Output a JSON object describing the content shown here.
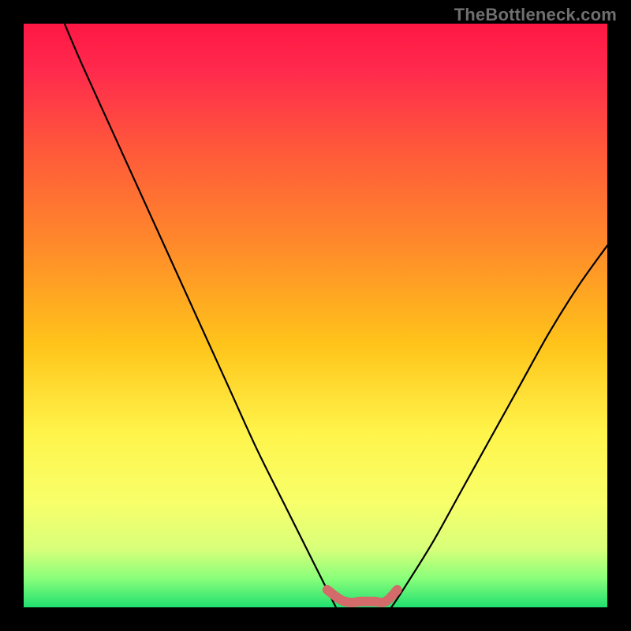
{
  "watermark": "TheBottleneck.com",
  "chart_data": {
    "type": "line",
    "title": "",
    "xlabel": "",
    "ylabel": "",
    "xlim": [
      0,
      100
    ],
    "ylim": [
      0,
      100
    ],
    "series": [
      {
        "name": "left-curve",
        "x": [
          7,
          10,
          15,
          20,
          25,
          30,
          35,
          40,
          45,
          50,
          53.5
        ],
        "values": [
          100,
          93,
          82,
          71,
          60,
          49,
          38,
          27,
          17,
          7,
          0
        ]
      },
      {
        "name": "right-curve",
        "x": [
          63,
          65,
          70,
          75,
          80,
          85,
          90,
          95,
          100
        ],
        "values": [
          0,
          3,
          11,
          20,
          29,
          38,
          47,
          55,
          62
        ]
      },
      {
        "name": "bottom-accent",
        "x": [
          52,
          55,
          58,
          60,
          62,
          64
        ],
        "values": [
          3,
          1,
          1,
          1,
          1,
          3
        ]
      }
    ],
    "gradient_stops": [
      {
        "offset": 0.0,
        "color": "#ff1744"
      },
      {
        "offset": 0.08,
        "color": "#ff2a4d"
      },
      {
        "offset": 0.22,
        "color": "#ff5a3a"
      },
      {
        "offset": 0.38,
        "color": "#ff8a2a"
      },
      {
        "offset": 0.55,
        "color": "#ffc41a"
      },
      {
        "offset": 0.7,
        "color": "#fff44a"
      },
      {
        "offset": 0.82,
        "color": "#f8ff6a"
      },
      {
        "offset": 0.9,
        "color": "#d8ff7a"
      },
      {
        "offset": 0.95,
        "color": "#8aff7a"
      },
      {
        "offset": 1.0,
        "color": "#20e070"
      }
    ],
    "accent_color": "#d36b6b",
    "curve_color": "#000000"
  }
}
